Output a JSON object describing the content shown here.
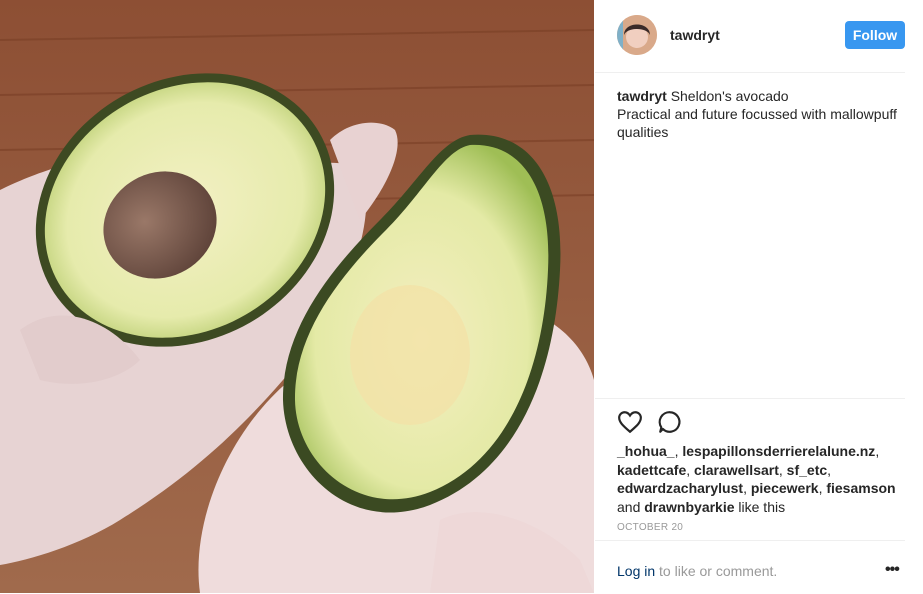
{
  "post": {
    "image": {
      "description_icon": "avocado-photo"
    },
    "header": {
      "username": "tawdryt",
      "follow_label": "Follow"
    },
    "caption": {
      "username": "tawdryt",
      "line1": "Sheldon's avocado",
      "line2": "Practical and future focussed with mallowpuff qualities"
    },
    "actions": {
      "like_icon": "heart-icon",
      "comment_icon": "comment-icon"
    },
    "likes": {
      "users": [
        "_hohua_",
        "lespapillonsderrierelalune.nz",
        "kadettcafe",
        "clarawellsart",
        "sf_etc",
        "edwardzacharylust",
        "piecewerk",
        "fiesamson"
      ],
      "and_text": "and",
      "last_user": "drawnbyarkie",
      "suffix": "like this"
    },
    "date": "OCTOBER 20",
    "footer": {
      "login_link": "Log in",
      "login_rest": "to like or comment.",
      "more_label": "•••"
    },
    "colors": {
      "accent": "#3897f0",
      "link": "#003569",
      "muted": "#999999"
    }
  }
}
